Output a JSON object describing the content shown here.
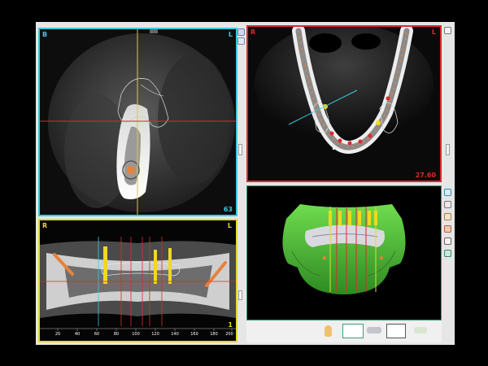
{
  "colors": {
    "coronal_border": "#3cc8e0",
    "axial_border": "#e0282d",
    "panoramic_border": "#e6d82a",
    "render_border": "#3aa07a",
    "implant": "#f0d820",
    "nerve": "#e8823a",
    "bone_3d": "#4bc43a"
  },
  "views": {
    "coronal": {
      "left_marker": "B",
      "right_marker": "L",
      "slice_number": "63"
    },
    "axial": {
      "left_marker": "R",
      "right_marker": "L",
      "measurement": "27.60"
    },
    "panoramic": {
      "left_marker": "R",
      "right_marker": "L",
      "index": "1",
      "ruler_labels": [
        "20",
        "40",
        "60",
        "80",
        "100",
        "120",
        "140",
        "160",
        "180",
        "200"
      ]
    }
  },
  "toolbars": {
    "coronal_side": [
      "cursor-icon",
      "zoom-icon"
    ],
    "axial_side": [
      "settings-icon"
    ],
    "render_side": [
      "layers-icon",
      "eye-icon",
      "palette-icon",
      "hand-icon",
      "rotate-icon",
      "cube-icon"
    ],
    "render_bottom": [
      "ear-icon",
      "jaw-arch-icon",
      "mandible-icon",
      "curve-edit-icon",
      "tooth-icon"
    ]
  }
}
